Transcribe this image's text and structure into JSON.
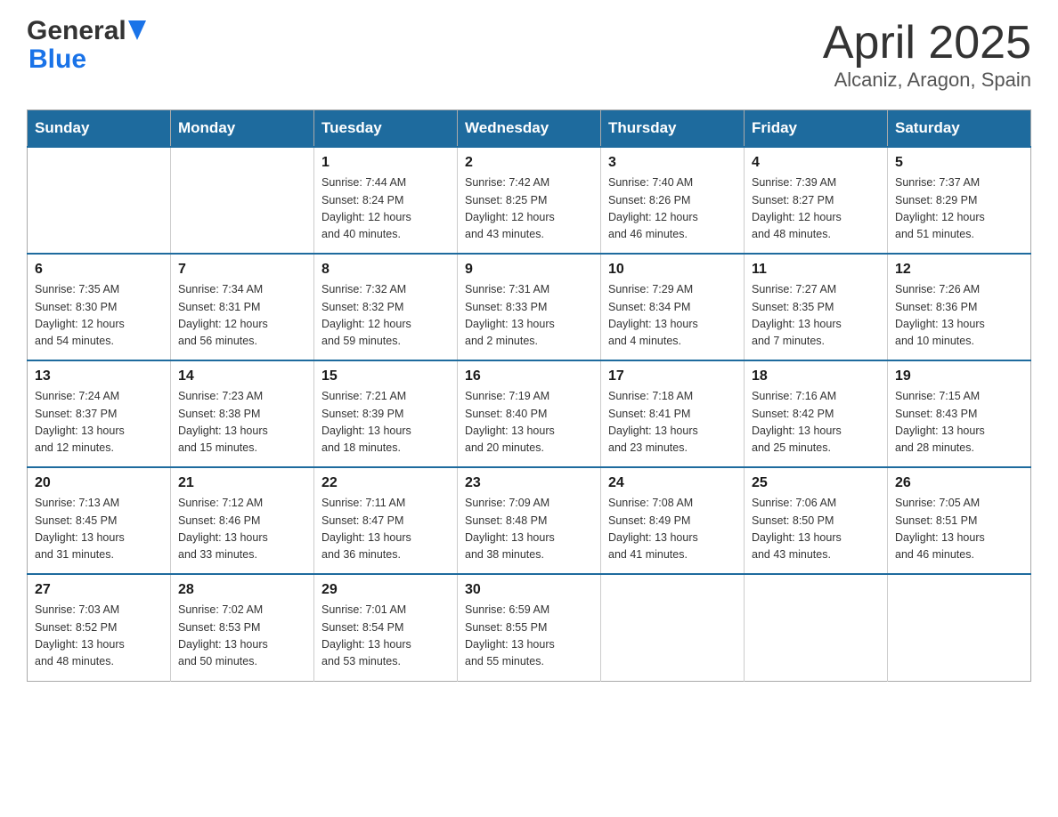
{
  "header": {
    "logo_text_black": "General",
    "logo_text_blue": "Blue",
    "title": "April 2025",
    "subtitle": "Alcaniz, Aragon, Spain"
  },
  "calendar": {
    "headers": [
      "Sunday",
      "Monday",
      "Tuesday",
      "Wednesday",
      "Thursday",
      "Friday",
      "Saturday"
    ],
    "weeks": [
      [
        {
          "day": "",
          "info": ""
        },
        {
          "day": "",
          "info": ""
        },
        {
          "day": "1",
          "info": "Sunrise: 7:44 AM\nSunset: 8:24 PM\nDaylight: 12 hours\nand 40 minutes."
        },
        {
          "day": "2",
          "info": "Sunrise: 7:42 AM\nSunset: 8:25 PM\nDaylight: 12 hours\nand 43 minutes."
        },
        {
          "day": "3",
          "info": "Sunrise: 7:40 AM\nSunset: 8:26 PM\nDaylight: 12 hours\nand 46 minutes."
        },
        {
          "day": "4",
          "info": "Sunrise: 7:39 AM\nSunset: 8:27 PM\nDaylight: 12 hours\nand 48 minutes."
        },
        {
          "day": "5",
          "info": "Sunrise: 7:37 AM\nSunset: 8:29 PM\nDaylight: 12 hours\nand 51 minutes."
        }
      ],
      [
        {
          "day": "6",
          "info": "Sunrise: 7:35 AM\nSunset: 8:30 PM\nDaylight: 12 hours\nand 54 minutes."
        },
        {
          "day": "7",
          "info": "Sunrise: 7:34 AM\nSunset: 8:31 PM\nDaylight: 12 hours\nand 56 minutes."
        },
        {
          "day": "8",
          "info": "Sunrise: 7:32 AM\nSunset: 8:32 PM\nDaylight: 12 hours\nand 59 minutes."
        },
        {
          "day": "9",
          "info": "Sunrise: 7:31 AM\nSunset: 8:33 PM\nDaylight: 13 hours\nand 2 minutes."
        },
        {
          "day": "10",
          "info": "Sunrise: 7:29 AM\nSunset: 8:34 PM\nDaylight: 13 hours\nand 4 minutes."
        },
        {
          "day": "11",
          "info": "Sunrise: 7:27 AM\nSunset: 8:35 PM\nDaylight: 13 hours\nand 7 minutes."
        },
        {
          "day": "12",
          "info": "Sunrise: 7:26 AM\nSunset: 8:36 PM\nDaylight: 13 hours\nand 10 minutes."
        }
      ],
      [
        {
          "day": "13",
          "info": "Sunrise: 7:24 AM\nSunset: 8:37 PM\nDaylight: 13 hours\nand 12 minutes."
        },
        {
          "day": "14",
          "info": "Sunrise: 7:23 AM\nSunset: 8:38 PM\nDaylight: 13 hours\nand 15 minutes."
        },
        {
          "day": "15",
          "info": "Sunrise: 7:21 AM\nSunset: 8:39 PM\nDaylight: 13 hours\nand 18 minutes."
        },
        {
          "day": "16",
          "info": "Sunrise: 7:19 AM\nSunset: 8:40 PM\nDaylight: 13 hours\nand 20 minutes."
        },
        {
          "day": "17",
          "info": "Sunrise: 7:18 AM\nSunset: 8:41 PM\nDaylight: 13 hours\nand 23 minutes."
        },
        {
          "day": "18",
          "info": "Sunrise: 7:16 AM\nSunset: 8:42 PM\nDaylight: 13 hours\nand 25 minutes."
        },
        {
          "day": "19",
          "info": "Sunrise: 7:15 AM\nSunset: 8:43 PM\nDaylight: 13 hours\nand 28 minutes."
        }
      ],
      [
        {
          "day": "20",
          "info": "Sunrise: 7:13 AM\nSunset: 8:45 PM\nDaylight: 13 hours\nand 31 minutes."
        },
        {
          "day": "21",
          "info": "Sunrise: 7:12 AM\nSunset: 8:46 PM\nDaylight: 13 hours\nand 33 minutes."
        },
        {
          "day": "22",
          "info": "Sunrise: 7:11 AM\nSunset: 8:47 PM\nDaylight: 13 hours\nand 36 minutes."
        },
        {
          "day": "23",
          "info": "Sunrise: 7:09 AM\nSunset: 8:48 PM\nDaylight: 13 hours\nand 38 minutes."
        },
        {
          "day": "24",
          "info": "Sunrise: 7:08 AM\nSunset: 8:49 PM\nDaylight: 13 hours\nand 41 minutes."
        },
        {
          "day": "25",
          "info": "Sunrise: 7:06 AM\nSunset: 8:50 PM\nDaylight: 13 hours\nand 43 minutes."
        },
        {
          "day": "26",
          "info": "Sunrise: 7:05 AM\nSunset: 8:51 PM\nDaylight: 13 hours\nand 46 minutes."
        }
      ],
      [
        {
          "day": "27",
          "info": "Sunrise: 7:03 AM\nSunset: 8:52 PM\nDaylight: 13 hours\nand 48 minutes."
        },
        {
          "day": "28",
          "info": "Sunrise: 7:02 AM\nSunset: 8:53 PM\nDaylight: 13 hours\nand 50 minutes."
        },
        {
          "day": "29",
          "info": "Sunrise: 7:01 AM\nSunset: 8:54 PM\nDaylight: 13 hours\nand 53 minutes."
        },
        {
          "day": "30",
          "info": "Sunrise: 6:59 AM\nSunset: 8:55 PM\nDaylight: 13 hours\nand 55 minutes."
        },
        {
          "day": "",
          "info": ""
        },
        {
          "day": "",
          "info": ""
        },
        {
          "day": "",
          "info": ""
        }
      ]
    ]
  }
}
